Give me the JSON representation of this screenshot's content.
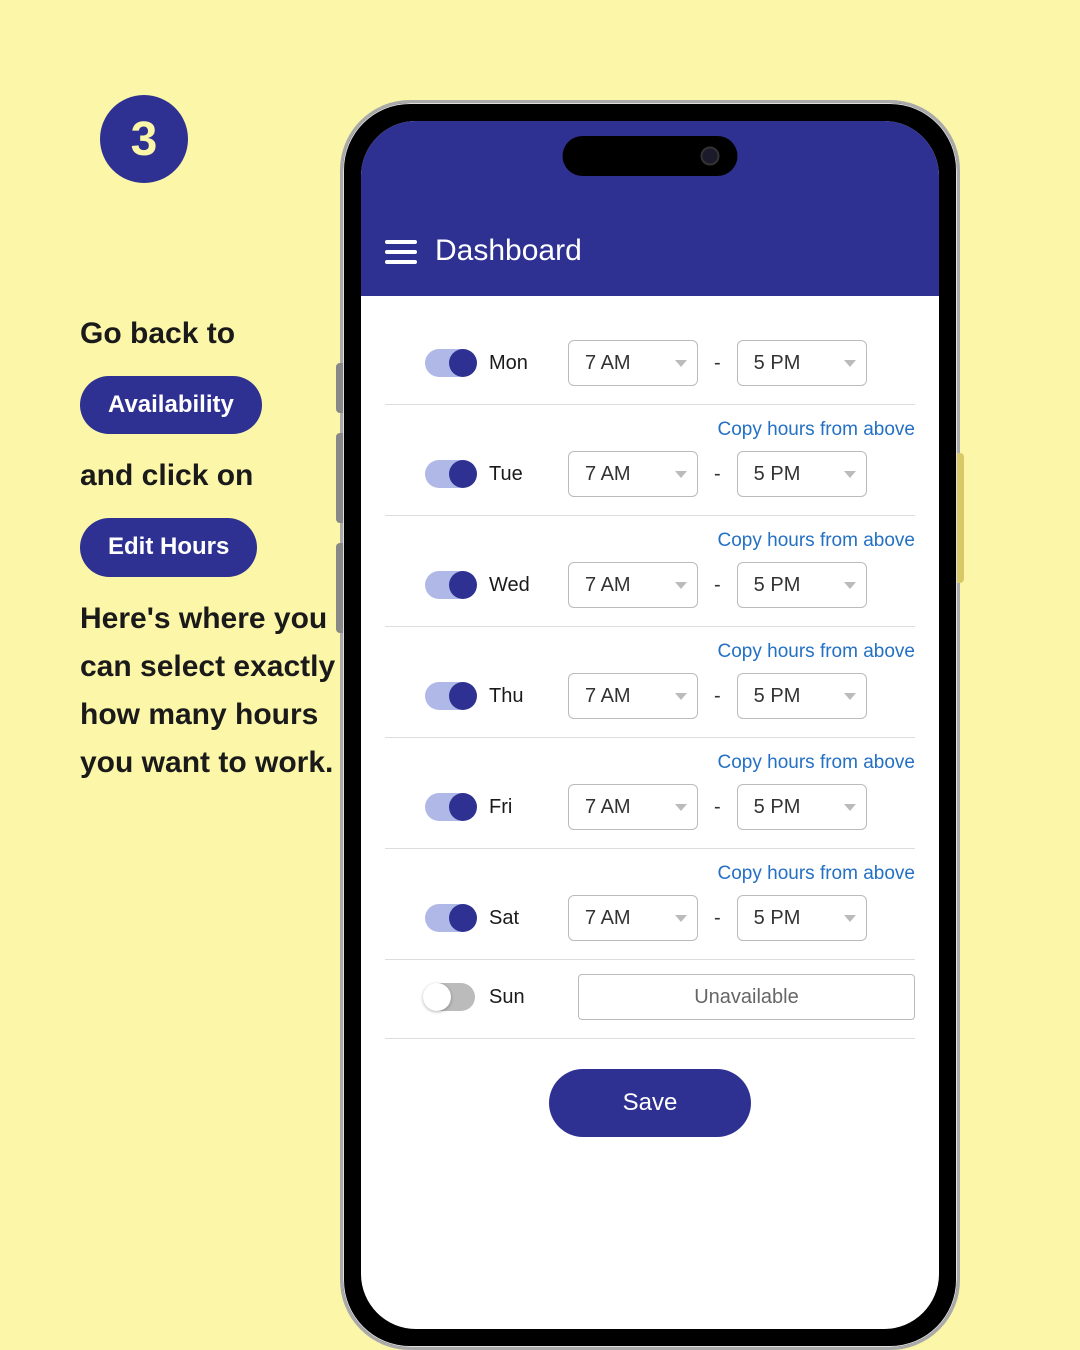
{
  "step_number": "3",
  "instructions": {
    "line1": "Go back to",
    "availability_pill": "Availability",
    "line2": "and click on",
    "edit_hours_pill": "Edit Hours",
    "line3": "Here's where you can select exactly how many hours you want to work."
  },
  "appbar": {
    "title": "Dashboard"
  },
  "copy_label": "Copy hours from above",
  "days": {
    "mon": {
      "label": "Mon",
      "start": "7 AM",
      "end": "5 PM"
    },
    "tue": {
      "label": "Tue",
      "start": "7 AM",
      "end": "5 PM"
    },
    "wed": {
      "label": "Wed",
      "start": "7 AM",
      "end": "5 PM"
    },
    "thu": {
      "label": "Thu",
      "start": "7 AM",
      "end": "5 PM"
    },
    "fri": {
      "label": "Fri",
      "start": "7 AM",
      "end": "5 PM"
    },
    "sat": {
      "label": "Sat",
      "start": "7 AM",
      "end": "5 PM"
    },
    "sun": {
      "label": "Sun"
    }
  },
  "unavailable_label": "Unavailable",
  "save_label": "Save"
}
